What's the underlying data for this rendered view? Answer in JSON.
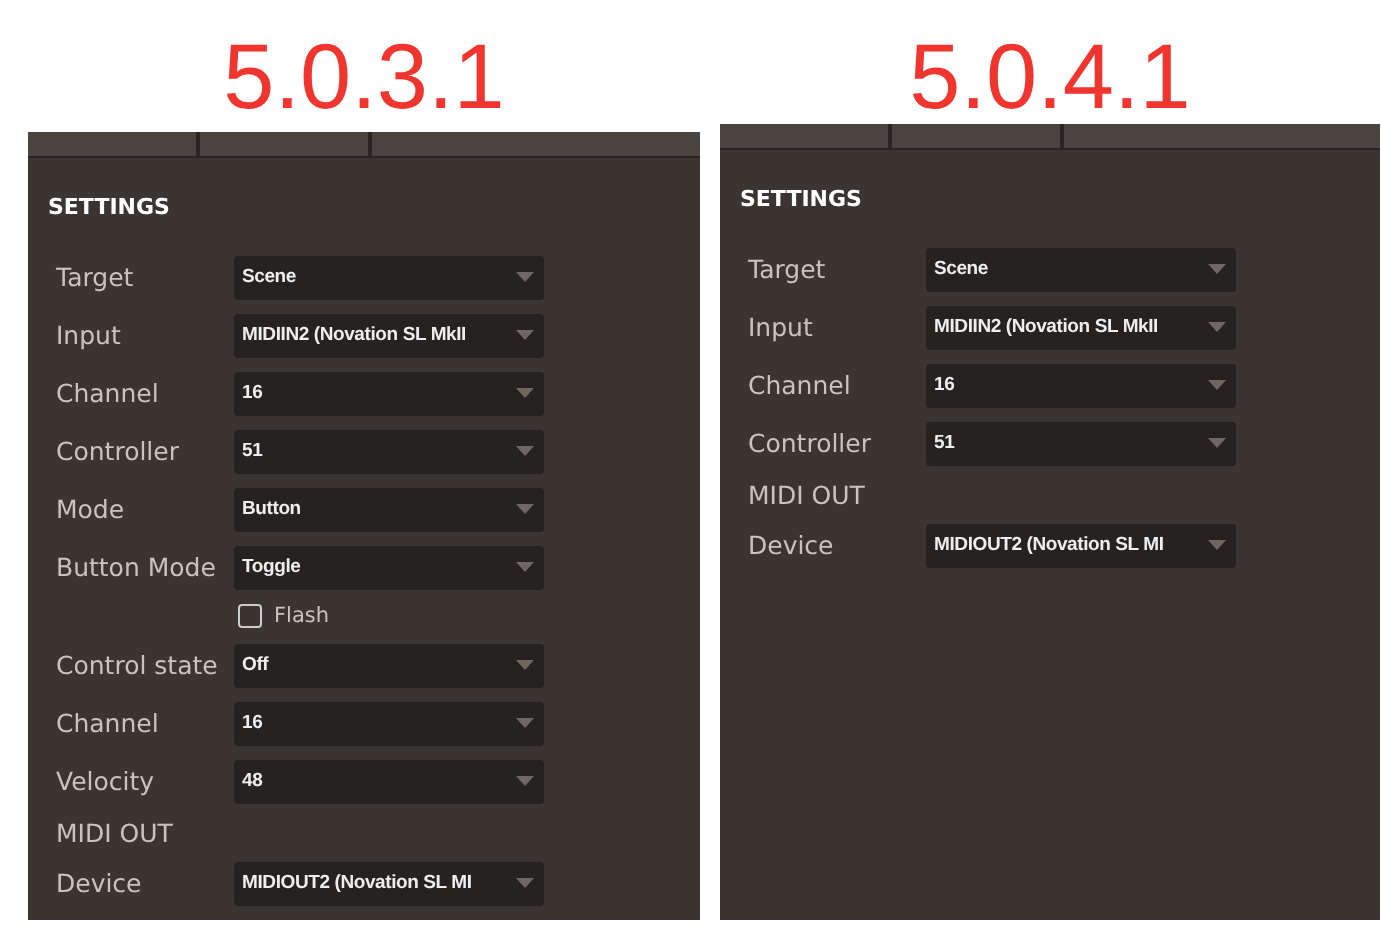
{
  "versions": [
    {
      "title": "5.0.3.1",
      "section": "SETTINGS",
      "rows": [
        {
          "kind": "select",
          "label": "Target",
          "value": "Scene"
        },
        {
          "kind": "select",
          "label": "Input",
          "value": "MIDIIN2 (Novation SL MkII"
        },
        {
          "kind": "select",
          "label": "Channel",
          "value": "16"
        },
        {
          "kind": "select",
          "label": "Controller",
          "value": "51"
        },
        {
          "kind": "select",
          "label": "Mode",
          "value": "Button"
        },
        {
          "kind": "select",
          "label": "Button Mode",
          "value": "Toggle"
        },
        {
          "kind": "checkbox",
          "label": "Flash",
          "checked": false
        },
        {
          "kind": "select",
          "label": "Control state",
          "value": "Off"
        },
        {
          "kind": "select",
          "label": "Channel",
          "value": "16"
        },
        {
          "kind": "select",
          "label": "Velocity",
          "value": "48"
        },
        {
          "kind": "heading",
          "label": "MIDI OUT"
        },
        {
          "kind": "select",
          "label": "Device",
          "value": "MIDIOUT2 (Novation SL MI"
        }
      ]
    },
    {
      "title": "5.0.4.1",
      "section": "SETTINGS",
      "rows": [
        {
          "kind": "select",
          "label": "Target",
          "value": "Scene"
        },
        {
          "kind": "select",
          "label": "Input",
          "value": "MIDIIN2 (Novation SL MkII"
        },
        {
          "kind": "select",
          "label": "Channel",
          "value": "16"
        },
        {
          "kind": "select",
          "label": "Controller",
          "value": "51"
        },
        {
          "kind": "heading",
          "label": "MIDI OUT"
        },
        {
          "kind": "select",
          "label": "Device",
          "value": "MIDIOUT2 (Novation SL MI"
        }
      ]
    }
  ]
}
